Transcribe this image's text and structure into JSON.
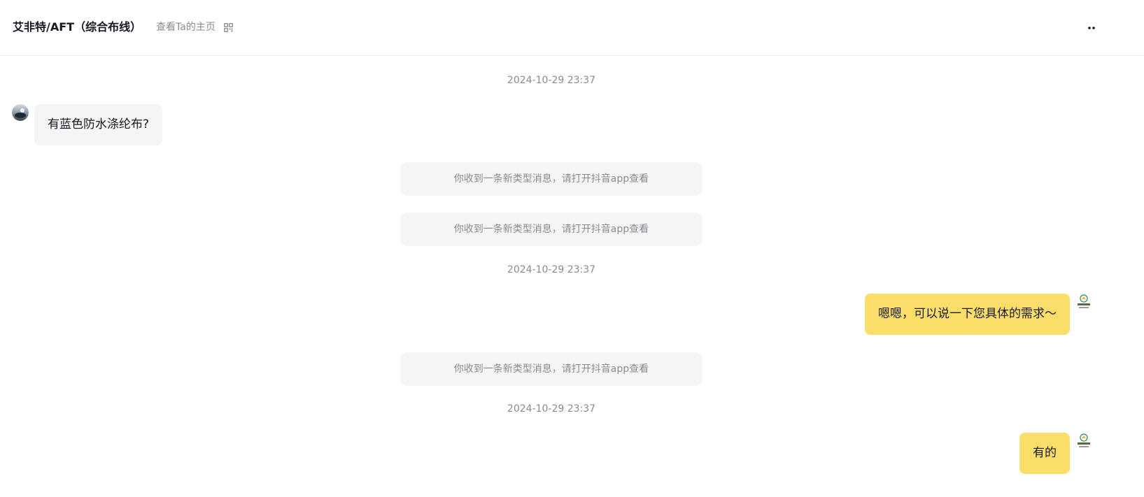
{
  "header": {
    "title": "艾非特/AFT（综合布线）",
    "profile_link": "查看Ta的主页",
    "qr_icon": "qr-code-icon",
    "more_icon": "more-dots-icon"
  },
  "messages": {
    "timestamp_1": "2024-10-29 23:37",
    "msg_1": "有蓝色防水涤纶布?",
    "system_1": "你收到一条新类型消息，请打开抖音app查看",
    "system_2": "你收到一条新类型消息，请打开抖音app查看",
    "timestamp_2": "2024-10-29 23:37",
    "msg_2": "嗯嗯，可以说一下您具体的需求～",
    "system_3": "你收到一条新类型消息，请打开抖音app查看",
    "timestamp_3": "2024-10-29 23:37",
    "msg_3": "有的"
  },
  "colors": {
    "own_bubble": "#fbde6a",
    "other_bubble": "#f5f5f5",
    "muted_text": "#8a8b91"
  }
}
